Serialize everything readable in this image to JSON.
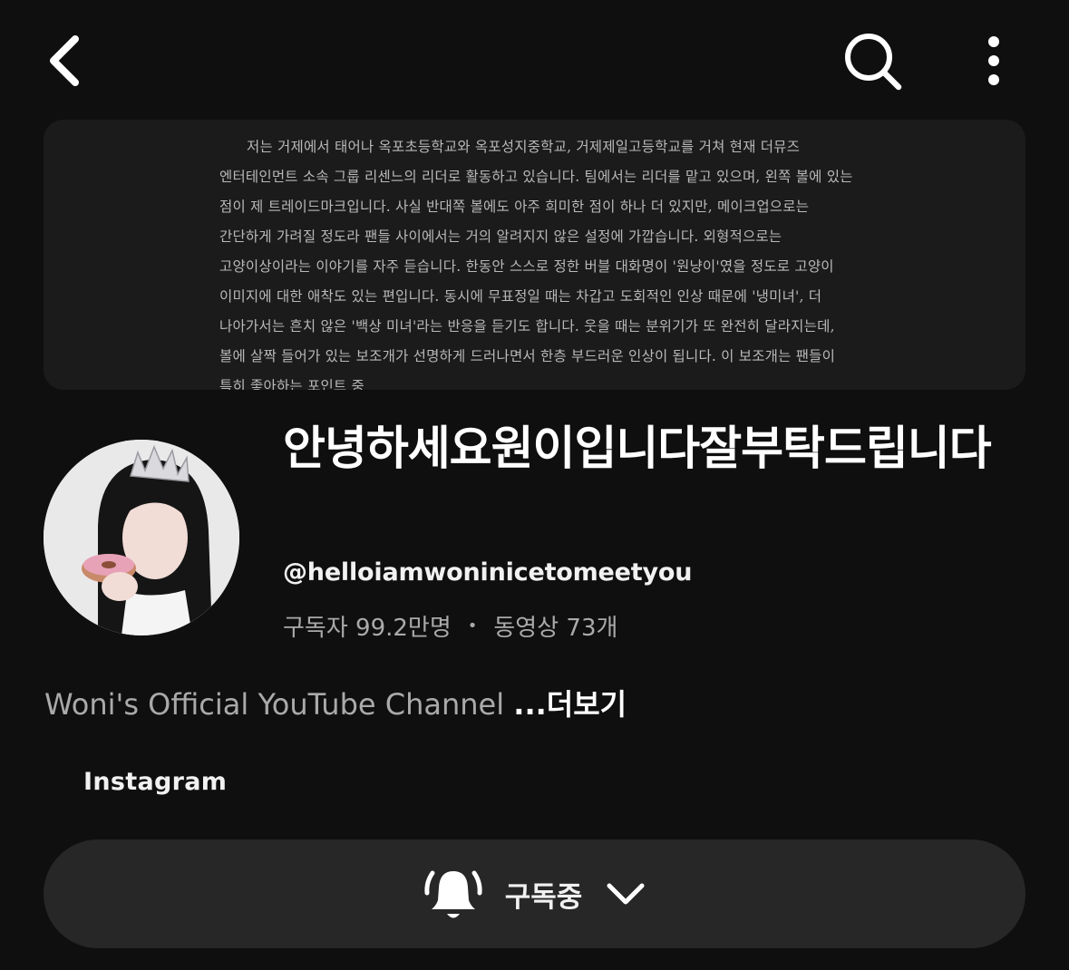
{
  "topbar": {
    "back_icon": "chevron-left-icon",
    "search_icon": "search-icon",
    "more_icon": "more-vertical-icon"
  },
  "banner": {
    "text": "저는 거제에서 태어나 옥포초등학교와 옥포성지중학교, 거제제일고등학교를 거쳐 현재 더뮤즈 엔터테인먼트 소속 그룹 리센느의 리더로 활동하고 있습니다. 팀에서는 리더를 맡고 있으며, 왼쪽 볼에 있는 점이 제 트레이드마크입니다. 사실 반대쪽 볼에도 아주 희미한 점이 하나 더 있지만, 메이크업으로는 간단하게 가려질 정도라 팬들 사이에서는 거의 알려지지 않은 설정에 가깝습니다. 외형적으로는 고양이상이라는 이야기를 자주 듣습니다. 한동안 스스로 정한 버블 대화명이 '원냥이'였을 정도로 고양이 이미지에 대한 애착도 있는 편입니다. 동시에 무표정일 때는 차갑고 도회적인 인상 때문에 '냉미녀', 더 나아가서는 흔치 않은 '백상 미녀'라는 반응을 듣기도 합니다. 웃을 때는 분위기가 또 완전히 달라지는데, 볼에 살짝 들어가 있는 보조개가 선명하게 드러나면서 한층 부드러운 인상이 됩니다. 이 보조개는 팬들이 특히 좋아하는 포인트 중"
  },
  "channel": {
    "name": "안녕하세요원이입니다잘부탁드립니다",
    "handle": "@helloiamwoninicetomeetyou",
    "subscribers": "구독자 99.2만명",
    "separator": "•",
    "videos": "동영상 73개",
    "description": "Woni's Official YouTube Channel",
    "more": "...더보기",
    "link": "Instagram"
  },
  "subscribe": {
    "label": "구독중",
    "bell_icon": "bell-ringing-icon",
    "chevron_icon": "chevron-down-icon"
  }
}
